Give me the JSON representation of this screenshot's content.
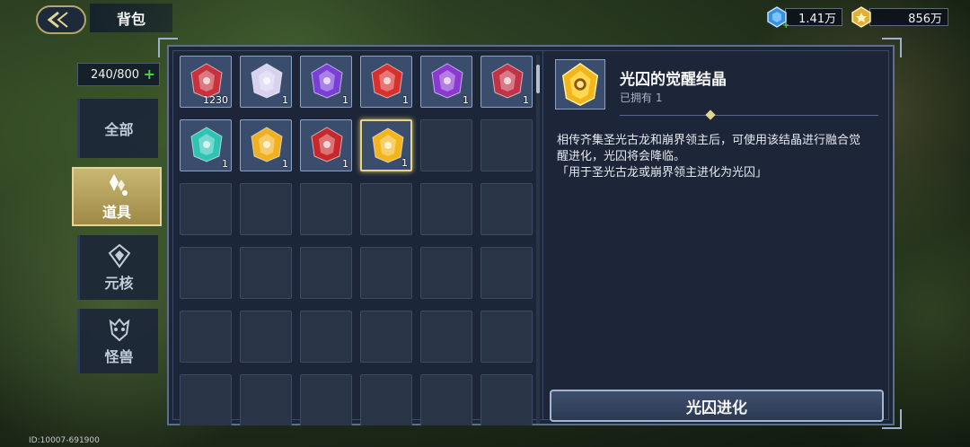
{
  "header": {
    "title": "背包"
  },
  "currency": [
    {
      "icon": "blue-gem-icon",
      "value": "1.41万"
    },
    {
      "icon": "gold-coin-icon",
      "value": "856万"
    }
  ],
  "inventory": {
    "count": "240/800"
  },
  "tabs": [
    {
      "label": "全部",
      "active": false
    },
    {
      "label": "道具",
      "active": true
    },
    {
      "label": "元核",
      "active": false
    },
    {
      "label": "怪兽",
      "active": false
    }
  ],
  "items": [
    {
      "name": "red-badge-item",
      "qty": "1230",
      "color": "#c8323c"
    },
    {
      "name": "white-flower-item",
      "qty": "1",
      "color": "#d8d2f0"
    },
    {
      "name": "purple-crystal-item",
      "qty": "1",
      "color": "#7a3fd6"
    },
    {
      "name": "red-crystal-item",
      "qty": "1",
      "color": "#d8302c"
    },
    {
      "name": "violet-crystal-item",
      "qty": "1",
      "color": "#8a3ad0"
    },
    {
      "name": "red-blue-crystal-item",
      "qty": "1",
      "color": "#c23348"
    },
    {
      "name": "cyan-crystal-item",
      "qty": "1",
      "color": "#2ec4b4"
    },
    {
      "name": "gold-crystal-item",
      "qty": "1",
      "color": "#f0b020"
    },
    {
      "name": "red-gold-crystal-item",
      "qty": "1",
      "color": "#c8282c"
    },
    {
      "name": "gold-awakening-crystal-item",
      "qty": "1",
      "color": "#f2b51c",
      "selected": true
    }
  ],
  "detail": {
    "title": "光囚的觉醒结晶",
    "owned": "已拥有 1",
    "description": "相传齐集圣光古龙和崩界领主后，可使用该结晶进行融合觉醒进化，光囚将会降临。",
    "quote": "「用于圣光古龙或崩界领主进化为光囚」",
    "action_label": "光囚进化"
  },
  "footer": {
    "id": "ID:10007-691900"
  }
}
